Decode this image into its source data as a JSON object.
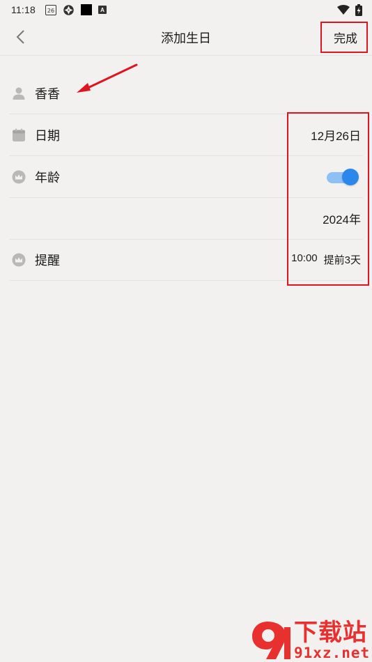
{
  "status_bar": {
    "time": "11:18",
    "calendar_day": "26",
    "app_letter": "A"
  },
  "nav": {
    "title": "添加生日",
    "done_label": "完成"
  },
  "rows": {
    "name": {
      "label": "香香",
      "icon": "person-icon"
    },
    "date": {
      "label": "日期",
      "value": "12月26日",
      "icon": "calendar-icon"
    },
    "age": {
      "label": "年龄",
      "toggle_on": true,
      "icon": "crown-icon"
    },
    "year": {
      "value": "2024年"
    },
    "reminder": {
      "label": "提醒",
      "time": "10:00",
      "advance": "提前3天",
      "icon": "crown-icon"
    }
  },
  "colors": {
    "background": "#f2f1f0",
    "toggle_track": "#8fc0f5",
    "toggle_knob": "#2b87ea",
    "annotation_red": "#e0141e",
    "icon_gray": "#b8b8b8"
  },
  "watermark": {
    "top": "下载站",
    "bottom": "91xz.net"
  }
}
